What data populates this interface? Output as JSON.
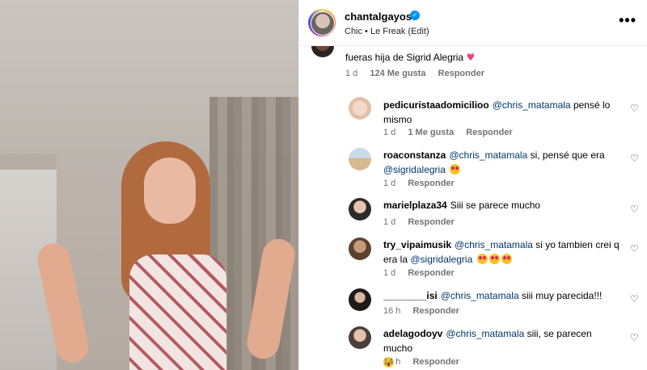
{
  "header": {
    "username": "chantalgayoso",
    "verified": true,
    "audio": "Chic • Le Freak (Edit)",
    "more_label": "•••"
  },
  "comments": [
    {
      "text": "fueras hija de Sigrid Alegria",
      "emoji": "pink-heart",
      "age": "1 d",
      "likes": "124 Me gusta",
      "reply": "Responder"
    },
    {
      "username": "pedicuristaadomicilioo",
      "mention": "@chris_matamala",
      "text": "pensé lo mismo",
      "age": "1 d",
      "likes": "1 Me gusta",
      "reply": "Responder"
    },
    {
      "username": "roaconstanza",
      "mention": "@chris_matamala",
      "text": "si, pensé que era",
      "mention2": "@sigridalegria",
      "age": "1 d",
      "reply": "Responder"
    },
    {
      "username": "marielplaza34",
      "text": "Siii se parece mucho",
      "age": "1 d",
      "reply": "Responder"
    },
    {
      "username": "try_vipaimusik",
      "mention": "@chris_matamala",
      "text": "si yo tambien crei q era la",
      "mention2": "@sigridalegria",
      "age": "1 d",
      "reply": "Responder"
    },
    {
      "username": "________isi",
      "mention": "@chris_matamala",
      "text": "siii muy parecida!!!",
      "age": "16 h",
      "reply": "Responder"
    },
    {
      "username": "adelagodoyv",
      "mention": "@chris_matamala",
      "text": "siii, se parecen mucho",
      "age": "14 h",
      "reply": "Responder"
    }
  ],
  "colors": {
    "mention": "#00376b",
    "meta": "#737373",
    "verified": "#0095f6"
  }
}
